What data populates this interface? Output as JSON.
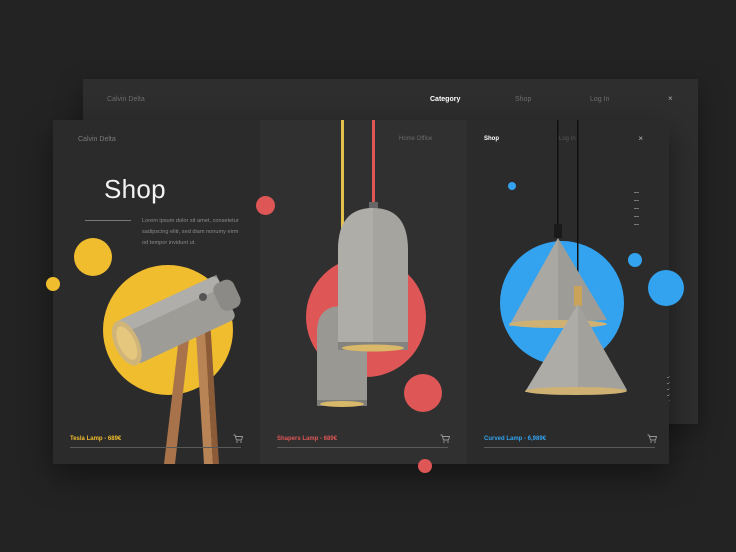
{
  "back_window": {
    "brand": "Calvin Delta",
    "nav": [
      "Category",
      "Shop",
      "Log In"
    ],
    "close": "×"
  },
  "panel1": {
    "brand": "Calvin Delta",
    "title": "Shop",
    "description_lines": [
      "Lorem ipsum dolor sit amet, consetetur",
      "sadipscing elitr, sed diam nonumy eirm",
      "od tempor invidunt ut."
    ],
    "product": "Tesla Lamp - 689€",
    "accent": "#f0bd2f"
  },
  "panel2": {
    "breadcrumb": "Home Office",
    "product": "Shapers Lamp - 689€",
    "accent": "#df5656"
  },
  "panel3": {
    "nav_shop": "Shop",
    "nav_login": "Log In",
    "close": "×",
    "product": "Curved Lamp - 6,989€",
    "accent": "#33a3f0"
  },
  "icons": {
    "cart": "cart-icon",
    "close": "close-icon"
  }
}
